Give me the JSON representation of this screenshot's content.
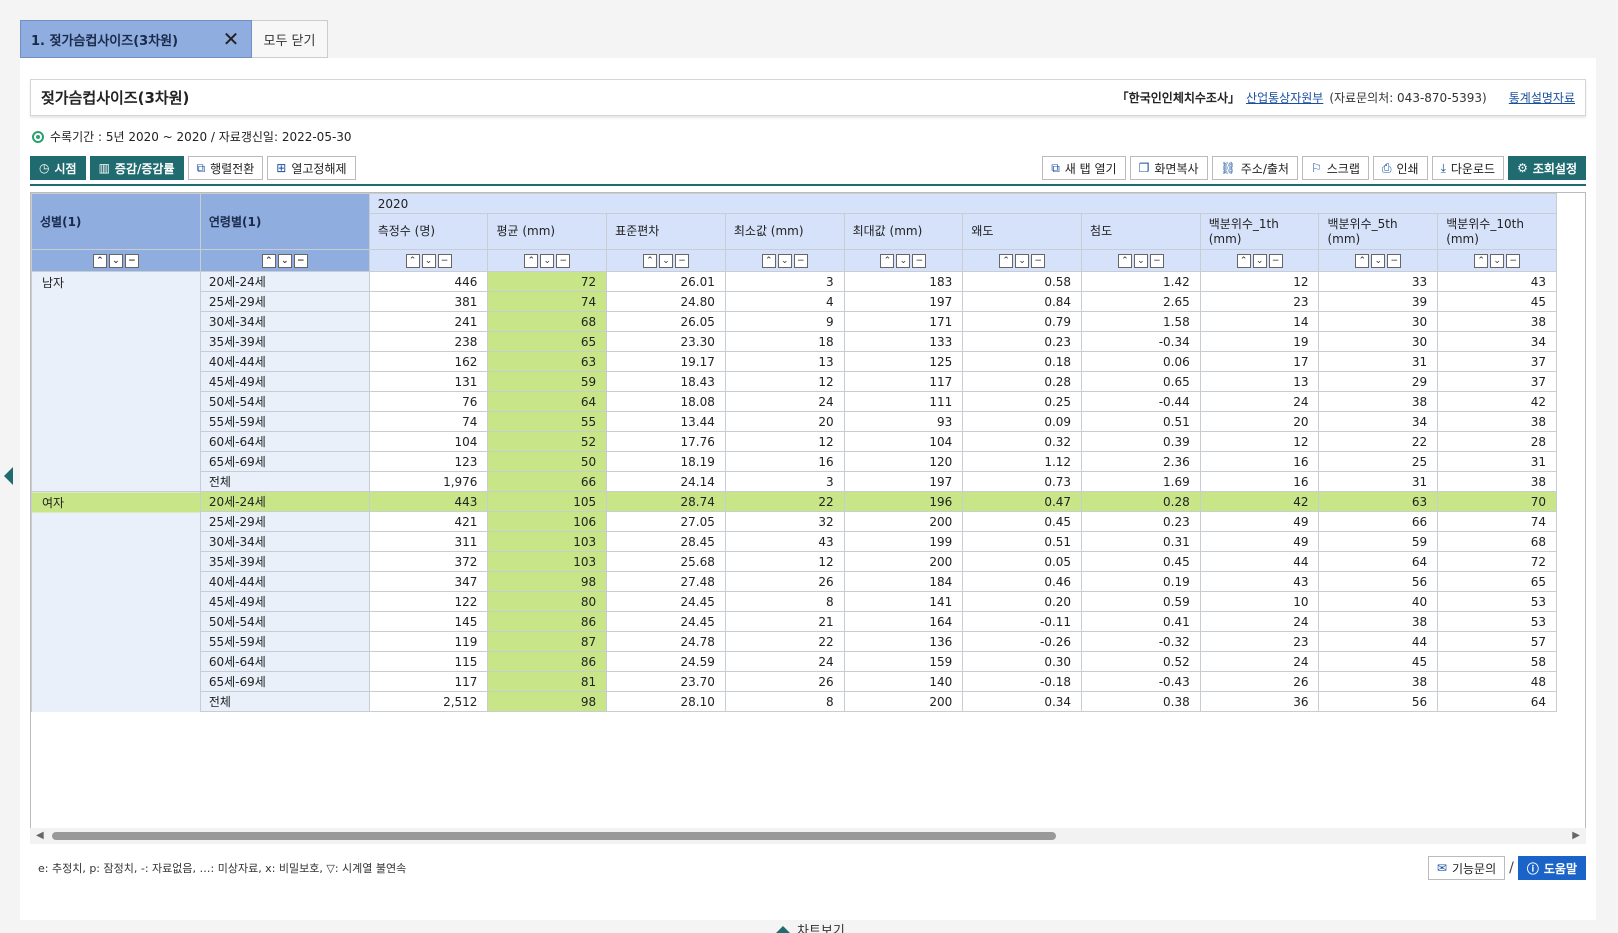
{
  "tab": {
    "label": "1. 젖가슴컵사이즈(3차원)",
    "close_all": "모두 닫기"
  },
  "title": "젖가슴컵사이즈(3차원)",
  "source": {
    "survey": "「한국인인체치수조사」",
    "org": "산업통상자원부",
    "contact": "(자료문의처: 043-870-5393)",
    "statdoc": "통계설명자료"
  },
  "period": "수록기간 : 5년 2020 ~ 2020 / 자료갱신일: 2022-05-30",
  "toolbar": {
    "left": [
      "시점",
      "증감/증감률",
      "행렬전환",
      "열고정해제"
    ],
    "right": [
      "새 탭 열기",
      "화면복사",
      "주소/출처",
      "스크랩",
      "인쇄",
      "다운로드",
      "조회설정"
    ]
  },
  "table": {
    "dim_headers": [
      "성별(1)",
      "연령별(1)"
    ],
    "year": "2020",
    "columns": [
      "측정수 (명)",
      "평균 (mm)",
      "표준편차",
      "최소값 (mm)",
      "최대값 (mm)",
      "왜도",
      "첨도",
      "백분위수_1th (mm)",
      "백분위수_5th (mm)",
      "백분위수_10th (mm)"
    ],
    "groups": [
      {
        "sex": "남자",
        "rows": [
          {
            "age": "20세-24세",
            "v": [
              "446",
              "72",
              "26.01",
              "3",
              "183",
              "0.58",
              "1.42",
              "12",
              "33",
              "43"
            ]
          },
          {
            "age": "25세-29세",
            "v": [
              "381",
              "74",
              "24.80",
              "4",
              "197",
              "0.84",
              "2.65",
              "23",
              "39",
              "45"
            ]
          },
          {
            "age": "30세-34세",
            "v": [
              "241",
              "68",
              "26.05",
              "9",
              "171",
              "0.79",
              "1.58",
              "14",
              "30",
              "38"
            ]
          },
          {
            "age": "35세-39세",
            "v": [
              "238",
              "65",
              "23.30",
              "18",
              "133",
              "0.23",
              "-0.34",
              "19",
              "30",
              "34"
            ]
          },
          {
            "age": "40세-44세",
            "v": [
              "162",
              "63",
              "19.17",
              "13",
              "125",
              "0.18",
              "0.06",
              "17",
              "31",
              "37"
            ]
          },
          {
            "age": "45세-49세",
            "v": [
              "131",
              "59",
              "18.43",
              "12",
              "117",
              "0.28",
              "0.65",
              "13",
              "29",
              "37"
            ]
          },
          {
            "age": "50세-54세",
            "v": [
              "76",
              "64",
              "18.08",
              "24",
              "111",
              "0.25",
              "-0.44",
              "24",
              "38",
              "42"
            ]
          },
          {
            "age": "55세-59세",
            "v": [
              "74",
              "55",
              "13.44",
              "20",
              "93",
              "0.09",
              "0.51",
              "20",
              "34",
              "38"
            ]
          },
          {
            "age": "60세-64세",
            "v": [
              "104",
              "52",
              "17.76",
              "12",
              "104",
              "0.32",
              "0.39",
              "12",
              "22",
              "28"
            ]
          },
          {
            "age": "65세-69세",
            "v": [
              "123",
              "50",
              "18.19",
              "16",
              "120",
              "1.12",
              "2.36",
              "16",
              "25",
              "31"
            ]
          },
          {
            "age": "전체",
            "v": [
              "1,976",
              "66",
              "24.14",
              "3",
              "197",
              "0.73",
              "1.69",
              "16",
              "31",
              "38"
            ]
          }
        ]
      },
      {
        "sex": "여자",
        "rows": [
          {
            "age": "20세-24세",
            "v": [
              "443",
              "105",
              "28.74",
              "22",
              "196",
              "0.47",
              "0.28",
              "42",
              "63",
              "70"
            ]
          },
          {
            "age": "25세-29세",
            "v": [
              "421",
              "106",
              "27.05",
              "32",
              "200",
              "0.45",
              "0.23",
              "49",
              "66",
              "74"
            ]
          },
          {
            "age": "30세-34세",
            "v": [
              "311",
              "103",
              "28.45",
              "43",
              "199",
              "0.51",
              "0.31",
              "49",
              "59",
              "68"
            ]
          },
          {
            "age": "35세-39세",
            "v": [
              "372",
              "103",
              "25.68",
              "12",
              "200",
              "0.05",
              "0.45",
              "44",
              "64",
              "72"
            ]
          },
          {
            "age": "40세-44세",
            "v": [
              "347",
              "98",
              "27.48",
              "26",
              "184",
              "0.46",
              "0.19",
              "43",
              "56",
              "65"
            ]
          },
          {
            "age": "45세-49세",
            "v": [
              "122",
              "80",
              "24.45",
              "8",
              "141",
              "0.20",
              "0.59",
              "10",
              "40",
              "53"
            ]
          },
          {
            "age": "50세-54세",
            "v": [
              "145",
              "86",
              "24.45",
              "21",
              "164",
              "-0.11",
              "0.41",
              "24",
              "38",
              "53"
            ]
          },
          {
            "age": "55세-59세",
            "v": [
              "119",
              "87",
              "24.78",
              "22",
              "136",
              "-0.26",
              "-0.32",
              "23",
              "44",
              "57"
            ]
          },
          {
            "age": "60세-64세",
            "v": [
              "115",
              "86",
              "24.59",
              "24",
              "159",
              "0.30",
              "0.52",
              "24",
              "45",
              "58"
            ]
          },
          {
            "age": "65세-69세",
            "v": [
              "117",
              "81",
              "23.70",
              "26",
              "140",
              "-0.18",
              "-0.43",
              "26",
              "38",
              "48"
            ]
          },
          {
            "age": "전체",
            "v": [
              "2,512",
              "98",
              "28.10",
              "8",
              "200",
              "0.34",
              "0.38",
              "36",
              "56",
              "64"
            ]
          }
        ]
      }
    ]
  },
  "legend": "e: 추정치, p: 잠정치, -: 자료없음, …: 미상자료, x: 비밀보호, ▽: 시계열 불연속",
  "bottom": {
    "inquiry": "기능문의",
    "help": "도움말",
    "chart_view": "차트보기"
  },
  "colors": {
    "accent": "#1f6b6f",
    "header": "#8fadde",
    "highlight": "#c8e688",
    "help": "#1a63c8"
  }
}
